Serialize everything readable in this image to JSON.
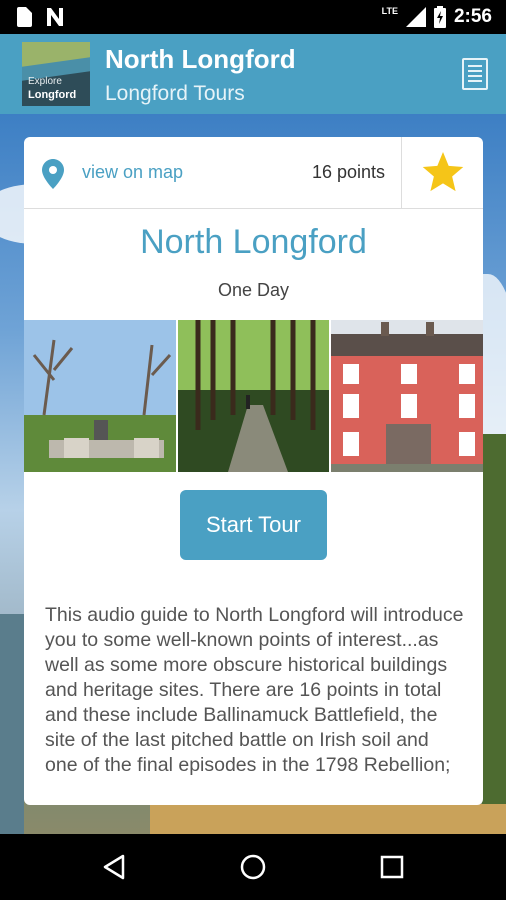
{
  "status_bar": {
    "time": "2:56",
    "network": "LTE"
  },
  "app_bar": {
    "logo": {
      "line1": "Explore",
      "line2": "Longford"
    },
    "title": "North Longford",
    "subtitle": "Longford Tours"
  },
  "card": {
    "map_link": "view on map",
    "points": "16 points",
    "title": "North Longford",
    "duration": "One Day",
    "start_button": "Start Tour",
    "description": "This audio guide to North Longford will introduce you to some well-known points of interest...as well as some more obscure historical buildings and heritage sites. There are 16 points in total and these include Ballinamuck Battlefield, the site of the last pitched battle on Irish soil and one of the final episodes in the 1798 Rebellion;"
  },
  "colors": {
    "accent": "#4aa0c3",
    "star": "#f5c518"
  },
  "icons": [
    "sim-card-icon",
    "notification-n-icon",
    "signal-icon",
    "battery-icon",
    "menu-icon",
    "map-pin-icon",
    "star-icon",
    "back-icon",
    "home-icon",
    "recents-icon"
  ]
}
